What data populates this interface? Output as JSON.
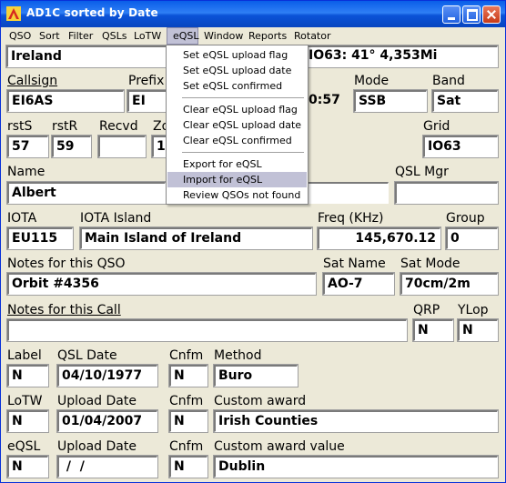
{
  "window": {
    "title": "AD1C sorted by Date"
  },
  "menu": {
    "items": [
      "QSO",
      "Sort",
      "Filter",
      "QSLs",
      "LoTW",
      "eQSL",
      "Window",
      "Reports",
      "Rotator"
    ],
    "active": "eQSL"
  },
  "dropdown": {
    "items": [
      "Set eQSL upload flag",
      "Set eQSL upload date",
      "Set eQSL confirmed",
      "Clear eQSL upload flag",
      "Clear eQSL upload date",
      "Clear eQSL confirmed",
      "Export for eQSL",
      "Import for eQSL",
      "Review QSOs not found"
    ],
    "highlighted": "Import for eQSL"
  },
  "form": {
    "country": "Ireland",
    "beam_info": "IO63: 41° 4,353Mi",
    "labels": {
      "callsign": "Callsign",
      "prefix": "Prefix",
      "mode": "Mode",
      "band": "Band",
      "rsts": "rstS",
      "rstr": "rstR",
      "recvd": "Recvd",
      "zone": "Zo",
      "grid": "Grid",
      "name": "Name",
      "qsl_mgr": "QSL Mgr",
      "iota": "IOTA",
      "iota_island": "IOTA Island",
      "freq": "Freq (KHz)",
      "group": "Group",
      "notes_qso": "Notes for this QSO",
      "sat_name": "Sat Name",
      "sat_mode": "Sat Mode",
      "notes_call": "Notes for this Call",
      "qrp": "QRP",
      "ylop": "YLop",
      "label": "Label",
      "qsl_date": "QSL Date",
      "cnfm": "Cnfm",
      "method": "Method",
      "lotw": "LoTW",
      "upload_date": "Upload Date",
      "custom_award": "Custom award",
      "eqsl": "eQSL",
      "custom_award_value": "Custom award value"
    },
    "values": {
      "callsign": "EI6AS",
      "prefix": "EI",
      "time": "0:57",
      "mode": "SSB",
      "band": "Sat",
      "rsts": "57",
      "rstr": "59",
      "recvd": "",
      "zone": "14",
      "grid": "IO63",
      "name": "Albert",
      "qsl_mgr": "",
      "iota": "EU115",
      "iota_island": "Main Island of Ireland",
      "freq": "145,670.12",
      "group": "0",
      "notes_qso": "Orbit #4356",
      "sat_name": "AO-7",
      "sat_mode": "70cm/2m",
      "notes_call": "",
      "qrp": "N",
      "ylop": "N",
      "label": "N",
      "qsl_date": "04/10/1977",
      "qsl_cnfm": "N",
      "method": "Buro",
      "lotw": "N",
      "lotw_upload_date": "01/04/2007",
      "lotw_cnfm": "N",
      "custom_award": "Irish Counties",
      "eqsl": "N",
      "eqsl_upload_date": " /  /",
      "eqsl_cnfm": "N",
      "custom_award_value": "Dublin"
    }
  }
}
